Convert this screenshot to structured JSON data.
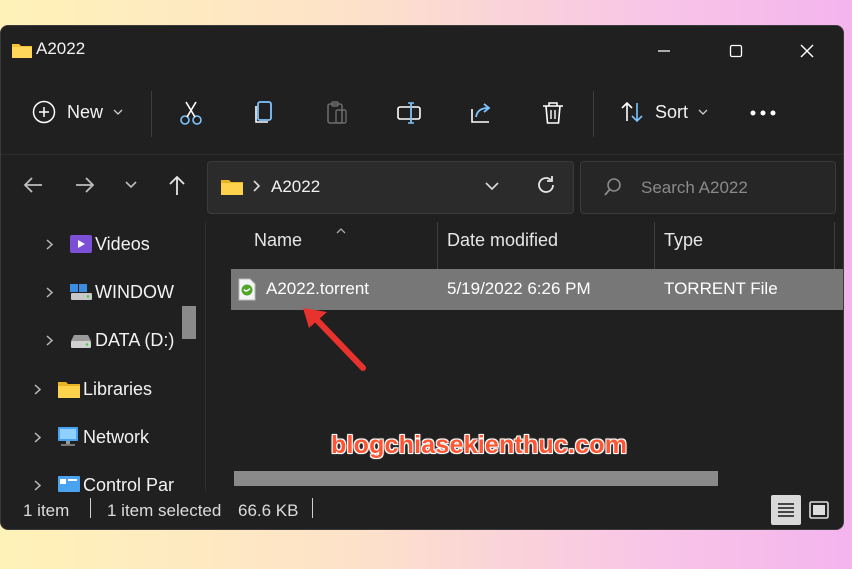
{
  "window": {
    "title": "A2022"
  },
  "commandbar": {
    "new_label": "New",
    "sort_label": "Sort"
  },
  "address": {
    "path_segment": "A2022"
  },
  "search": {
    "placeholder": "Search A2022"
  },
  "sidebar": {
    "items": [
      {
        "label": "Videos",
        "icon": "videos-icon"
      },
      {
        "label": "WINDOW",
        "icon": "drive-icon"
      },
      {
        "label": "DATA (D:)",
        "icon": "drive-icon"
      },
      {
        "label": "Libraries",
        "icon": "folder-icon"
      },
      {
        "label": "Network",
        "icon": "network-icon"
      },
      {
        "label": "Control Par",
        "icon": "control-panel-icon"
      }
    ]
  },
  "list": {
    "columns": [
      "Name",
      "Date modified",
      "Type"
    ],
    "rows": [
      {
        "name": "A2022.torrent",
        "date_modified": "5/19/2022 6:26 PM",
        "type": "TORRENT File",
        "selected": true
      }
    ]
  },
  "watermark": "blogchiasekienthuc.com",
  "status": {
    "item_count": "1 item",
    "selection": "1 item selected",
    "size": "66.6 KB"
  },
  "colors": {
    "window_bg": "#202020",
    "selection": "#777777",
    "arrow": "#e8322d",
    "folder": "#f4c430"
  }
}
